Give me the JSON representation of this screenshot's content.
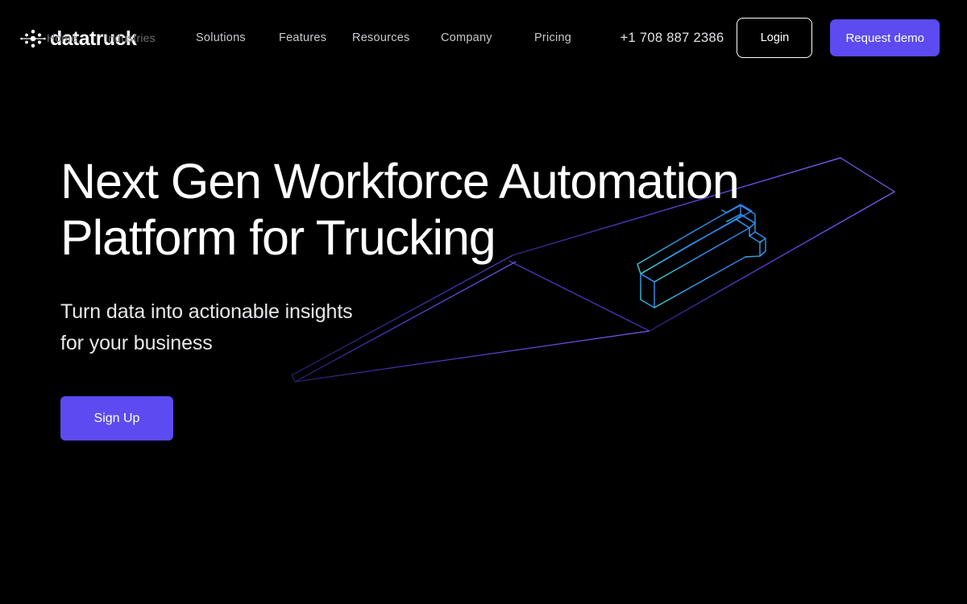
{
  "brand": {
    "logo_text": "datatruck",
    "logo_icon": "dots-constellation-icon"
  },
  "nav": {
    "ghost_items": [
      {
        "label": "Home"
      },
      {
        "label": "Industries"
      }
    ],
    "items": [
      {
        "label": "Solutions"
      },
      {
        "label": "Features"
      },
      {
        "label": "Resources"
      },
      {
        "label": "Company"
      },
      {
        "label": "Pricing"
      }
    ],
    "phone": "+1 708 887 2386",
    "login_label": "Login",
    "demo_label": "Request demo"
  },
  "hero": {
    "heading": "Next Gen Workforce Automation\nPlatform for Trucking",
    "subheading": "Turn data into actionable insights\nfor your business",
    "cta_label": "Sign Up"
  },
  "colors": {
    "background": "#000000",
    "accent_purple": "#5b4bf0",
    "text_primary": "#ffffff",
    "text_muted": "#c9c9ce",
    "road_purple": "#5b3fd4",
    "truck_blue": "#2f8fe8",
    "truck_teal": "#3fc9c4"
  },
  "art": {
    "road_label": "isometric-road-path",
    "truck_label": "isometric-truck-wireframe"
  }
}
